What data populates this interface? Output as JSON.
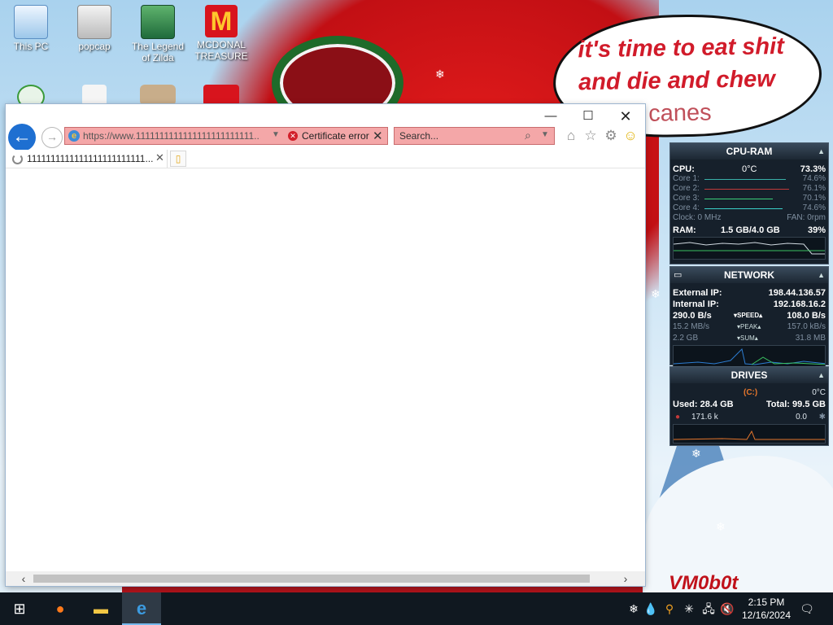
{
  "desktop": {
    "icons": [
      {
        "label": "This PC"
      },
      {
        "label": "popcap"
      },
      {
        "label": "The Legend of Zilda"
      },
      {
        "label": "MCDONAL TREASURE"
      }
    ],
    "bubble_lines": [
      "it's time to eat shit",
      "and die and chew",
      "candy canes"
    ],
    "watermark": "VM0b0t"
  },
  "browser": {
    "address_url": "https://www.1111111111111111111111111...",
    "certificate_error": "Certificate error",
    "search_placeholder": "Search...",
    "tab_title": "1111111111111111111111111...",
    "colors": {
      "address_error_bg": "#f4a7a8",
      "back_button": "#1e6fd1"
    }
  },
  "cpu_ram": {
    "title": "CPU-RAM",
    "cpu_label": "CPU:",
    "cpu_temp": "0°C",
    "cpu_value": "73.3%",
    "cores": [
      {
        "label": "Core 1:",
        "value": "74.6%"
      },
      {
        "label": "Core 2:",
        "value": "76.1%"
      },
      {
        "label": "Core 3:",
        "value": "70.1%"
      },
      {
        "label": "Core 4:",
        "value": "74.6%"
      }
    ],
    "clock": "Clock: 0 MHz",
    "fan": "FAN: 0rpm",
    "ram_label": "RAM:",
    "ram_used": "1.5 GB/4.0 GB",
    "ram_pct": "39%"
  },
  "network": {
    "title": "NETWORK",
    "external_label": "External IP:",
    "external_ip": "198.44.136.57",
    "internal_label": "Internal IP:",
    "internal_ip": "192.168.16.2",
    "speed_down": "290.0 B/s",
    "speed_label": "SPEED",
    "speed_up": "108.0 B/s",
    "peak_down": "15.2 MB/s",
    "peak_label": "PEAK",
    "peak_up": "157.0 kB/s",
    "sum_down": "2.2 GB",
    "sum_label": "SUM",
    "sum_up": "31.8 MB"
  },
  "drives": {
    "title": "DRIVES",
    "drive": "(C:)",
    "temp": "0°C",
    "used": "Used: 28.4 GB",
    "total": "Total: 99.5 GB",
    "read": "171.6 k",
    "write": "0.0"
  },
  "taskbar": {
    "time": "2:15 PM",
    "date": "12/16/2024"
  }
}
